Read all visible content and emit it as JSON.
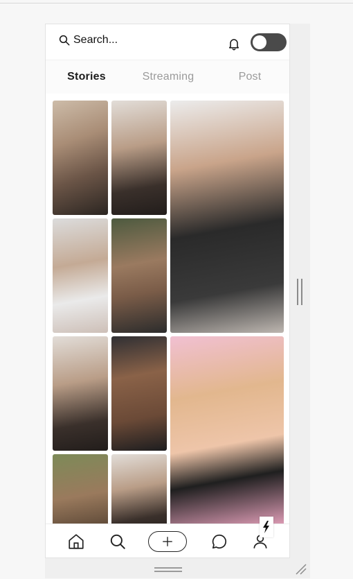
{
  "header": {
    "search_placeholder": "Search...",
    "icons": {
      "search": "search-icon",
      "notifications": "bell-icon",
      "toggle": "theme-toggle"
    },
    "toggle_state": "off"
  },
  "tabs": [
    {
      "label": "Stories",
      "active": true
    },
    {
      "label": "Streaming",
      "active": false
    },
    {
      "label": "Post",
      "active": false
    }
  ],
  "feed": {
    "photos": [
      {
        "kind": "woman-floral-robe"
      },
      {
        "kind": "woman-selfie-choker"
      },
      {
        "kind": "woman-black-top-tall"
      },
      {
        "kind": "woman-white-top"
      },
      {
        "kind": "man-shirtless-tattoos"
      },
      {
        "kind": "woman-selfie-choker"
      },
      {
        "kind": "man-shirtless-cap"
      },
      {
        "kind": "woman-blonde-pink-tall"
      },
      {
        "kind": "man-forest"
      },
      {
        "kind": "woman-selfie-choker"
      }
    ]
  },
  "bottom_nav": [
    {
      "name": "home",
      "icon": "home-icon"
    },
    {
      "name": "search",
      "icon": "search-icon"
    },
    {
      "name": "create",
      "icon": "plus-icon"
    },
    {
      "name": "messages",
      "icon": "chat-bubble-icon"
    },
    {
      "name": "profile",
      "icon": "user-icon"
    }
  ],
  "colors": {
    "toggle_bg": "#4a4a4a",
    "active_tab": "#1c1c1c",
    "inactive_tab": "#9a9a9a"
  }
}
